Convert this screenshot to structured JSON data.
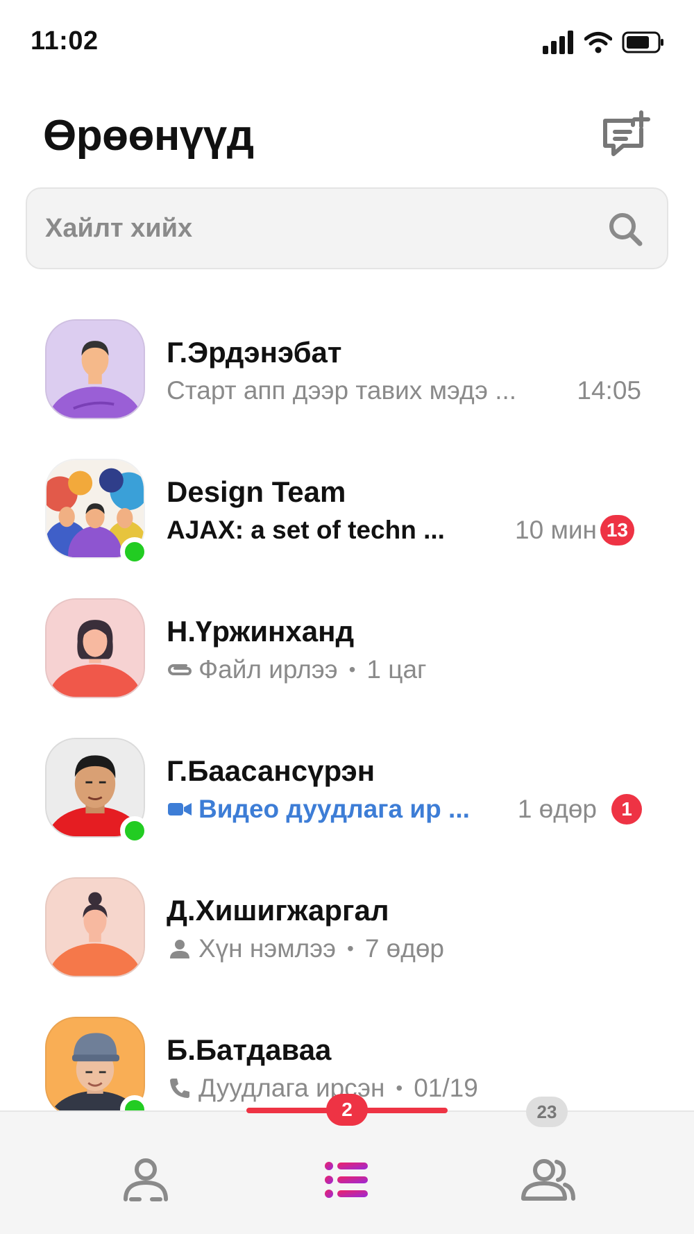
{
  "status_bar": {
    "time": "11:02",
    "icons": [
      "signal-icon",
      "wifi-icon",
      "battery-icon"
    ]
  },
  "header": {
    "title": "Өрөөнүүд",
    "compose_icon": "new-chat-icon"
  },
  "search": {
    "placeholder": "Хайлт хийх",
    "icon": "search-icon"
  },
  "chats": [
    {
      "name": "Г.Эрдэнэбат",
      "preview": "Старт апп дээр тавих мэдэ ...",
      "time": "14:05",
      "online": false,
      "unread": null,
      "avatar": "avatar-male-purple"
    },
    {
      "name": "Design Team",
      "preview": "AJAX: a set of techn ...",
      "time": "10 мин",
      "online": true,
      "unread": "13",
      "avatar": "group-illustration"
    },
    {
      "name": "Н.Үржинханд",
      "preview_icon": "attachment-icon",
      "preview": "Файл ирлээ",
      "sep": "•",
      "meta": "1 цаг",
      "online": false,
      "unread": null,
      "avatar": "avatar-female-red"
    },
    {
      "name": "Г.Баасансүрэн",
      "preview_icon": "video-camera-icon",
      "preview": "Видео дуудлага ир ...",
      "time": "1 өдөр",
      "online": true,
      "unread": "1",
      "avatar": "photo-male"
    },
    {
      "name": "Д.Хишигжаргал",
      "preview_icon": "person-icon",
      "preview": "Хүн нэмлээ",
      "sep": "•",
      "meta": "7 өдөр",
      "online": false,
      "unread": null,
      "avatar": "avatar-female-orange"
    },
    {
      "name": "Б.Батдаваа",
      "preview_icon": "phone-icon",
      "preview": "Дуудлага ирсэн",
      "sep": "•",
      "meta": "01/19",
      "online": true,
      "unread": null,
      "avatar": "photo-male-cap"
    }
  ],
  "tab_bar": {
    "tabs": [
      {
        "id": "contacts",
        "icon": "contact-icon",
        "active": false
      },
      {
        "id": "chats",
        "icon": "list-icon",
        "active": true,
        "badge": "2"
      },
      {
        "id": "groups",
        "icon": "group-icon",
        "active": false,
        "badge": "23"
      }
    ]
  },
  "colors": {
    "accent": "#ee3344",
    "online": "#22cc22",
    "link_blue": "#3d7dd6",
    "muted_text": "#8a8a8a"
  }
}
